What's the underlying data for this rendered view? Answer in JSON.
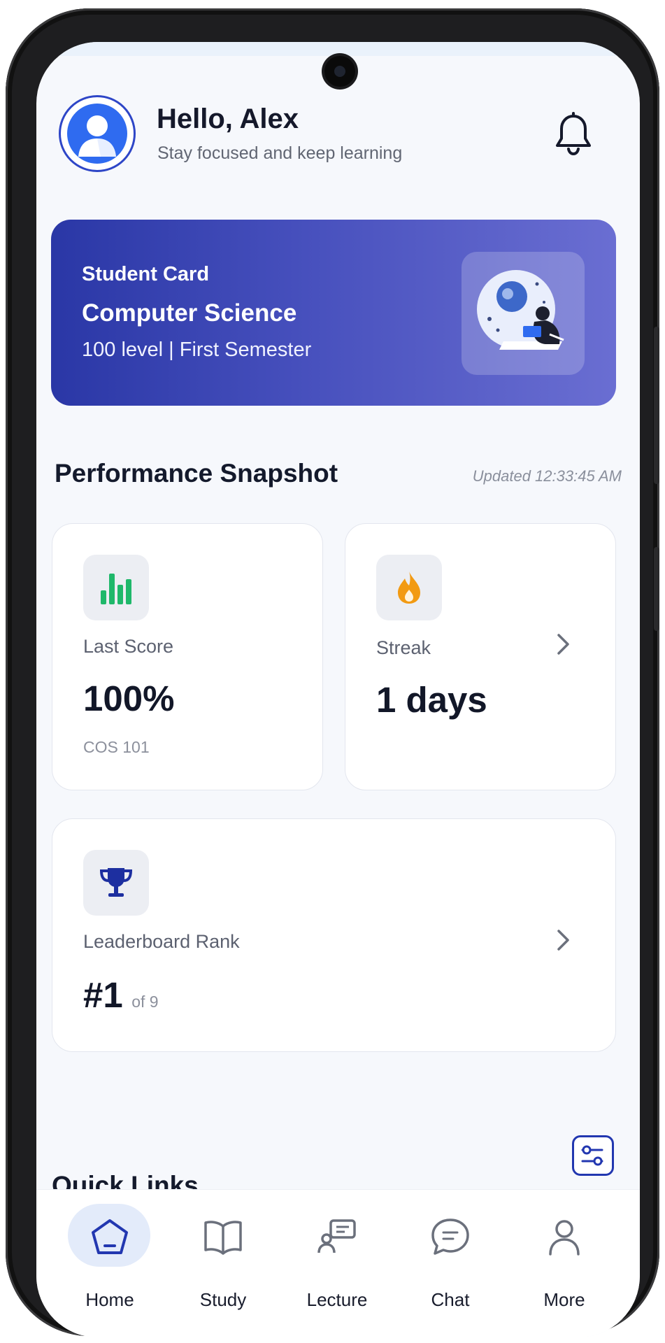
{
  "header": {
    "greeting": "Hello, Alex",
    "subtitle": "Stay focused and keep learning"
  },
  "student_card": {
    "label": "Student Card",
    "department": "Computer Science",
    "level": "100 level | First Semester"
  },
  "performance": {
    "title": "Performance Snapshot",
    "updated": "Updated 12:33:45 AM",
    "last_score": {
      "label": "Last Score",
      "value": "100%",
      "course": "COS 101"
    },
    "streak": {
      "label": "Streak",
      "value": "1 days"
    },
    "rank": {
      "label": "Leaderboard Rank",
      "value": "#1",
      "of": "of 9"
    }
  },
  "quick_links": {
    "title": "Quick Links"
  },
  "nav": {
    "items": [
      {
        "label": "Home",
        "icon": "home-icon",
        "active": true
      },
      {
        "label": "Study",
        "icon": "book-icon",
        "active": false
      },
      {
        "label": "Lecture",
        "icon": "lecture-icon",
        "active": false
      },
      {
        "label": "Chat",
        "icon": "chat-icon",
        "active": false
      },
      {
        "label": "More",
        "icon": "user-icon",
        "active": false
      }
    ]
  },
  "colors": {
    "accent": "#2237b0",
    "card_gradient_start": "#2a37a6",
    "card_gradient_end": "#6a6ed2",
    "chart_green": "#1fb86a",
    "flame_orange": "#f29a12"
  }
}
